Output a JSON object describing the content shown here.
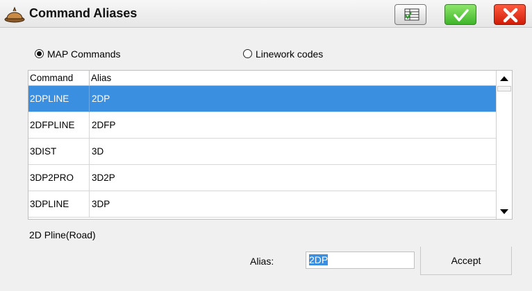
{
  "window": {
    "title": "Command Aliases",
    "app_icon": "hardhat-icon",
    "buttons": {
      "table_icon": "table-icon",
      "ok_icon": "checkmark-icon",
      "close_icon": "close-icon"
    }
  },
  "radios": {
    "map_commands": {
      "label": "MAP Commands",
      "checked": true
    },
    "linework_codes": {
      "label": "Linework codes",
      "checked": false
    }
  },
  "table": {
    "columns": [
      "Command",
      "Alias"
    ],
    "rows": [
      {
        "command": "2DPLINE",
        "alias": "2DP",
        "selected": true
      },
      {
        "command": "2DFPLINE",
        "alias": "2DFP",
        "selected": false
      },
      {
        "command": "3DIST",
        "alias": "3D",
        "selected": false
      },
      {
        "command": "3DP2PRO",
        "alias": "3D2P",
        "selected": false
      },
      {
        "command": "3DPLINE",
        "alias": "3DP",
        "selected": false
      }
    ]
  },
  "description": "2D Pline(Road)",
  "alias_field": {
    "label": "Alias:",
    "value": "2DP"
  },
  "accept_label": "Accept",
  "colors": {
    "selection": "#3b8fe0",
    "ok_green": "#3fb52a",
    "close_red": "#d01d08"
  }
}
